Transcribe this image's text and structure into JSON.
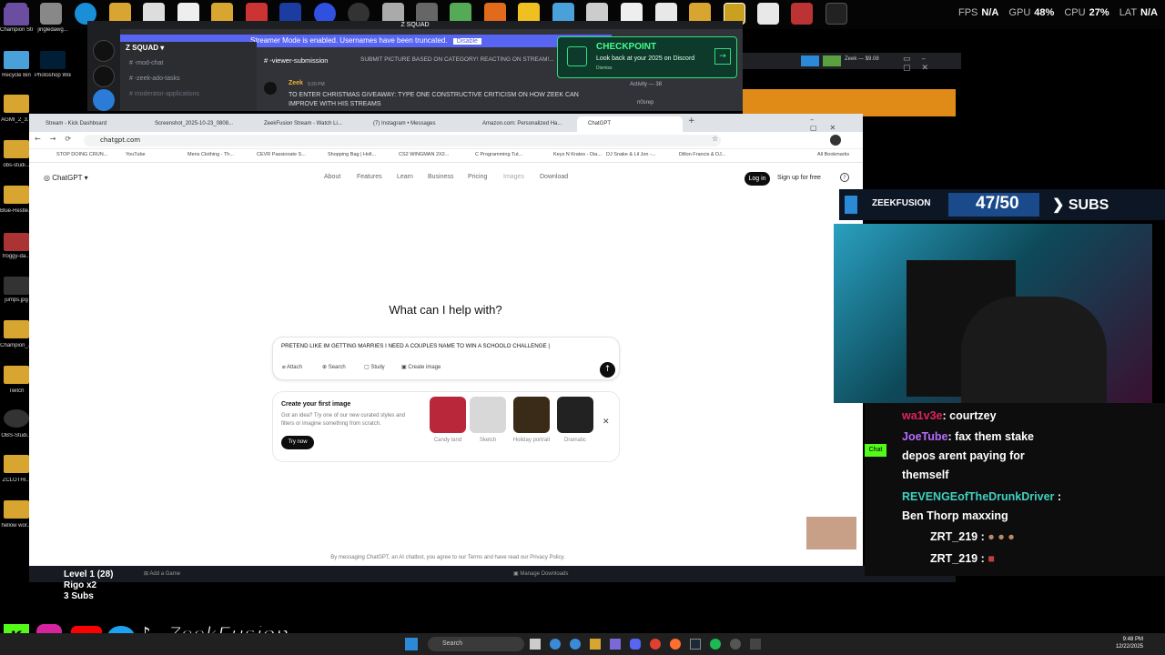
{
  "perf": {
    "fps_label": "FPS",
    "fps": "N/A",
    "gpu_label": "GPU",
    "gpu": "48%",
    "cpu_label": "CPU",
    "cpu": "27%",
    "lat_label": "LAT",
    "lat": "N/A"
  },
  "desktop_icons": [
    "Champion Stream Ov...",
    "Recycle Bin",
    "AGMI_2_3...",
    "obs-studi...",
    "Blue-Restle...",
    "froggy-da...",
    "jumps.jpg",
    "Champion_...",
    "Twitch",
    "OBS-Studi...",
    "ZCLOTHI...",
    "hellow wor..."
  ],
  "desktop_icons2": [
    "jingledawg...",
    "Photoshop Work"
  ],
  "discord": {
    "window_title": "Z SQUAD",
    "banner_text": "Streamer Mode is enabled. Usernames have been truncated.",
    "banner_button": "Disable",
    "server_name": "Z SQUAD",
    "channels": [
      "-mod-chat",
      "-zeek-ado-tasks",
      "moderator-applications"
    ],
    "channel_header": "-viewer-submission",
    "channel_topic": "SUBMIT PICTURE BASED ON CATEGORY! REACTING ON STREAM!...",
    "author": "Zeek",
    "time": "9:20 PM",
    "message": "TO ENTER CHRISTMAS GIVEAWAY: TYPE ONE CONSTRUCTIVE CRITICISM ON HOW ZEEK CAN IMPROVE WITH HIS STREAMS",
    "activity": "Activity — 38",
    "activity_user": "n0srep"
  },
  "checkpoint": {
    "title": "CHECKPOINT",
    "subtitle": "Look back at your 2025 on Discord",
    "dismiss": "Dismiss"
  },
  "right_window": {
    "title": "Zeek — $9.08"
  },
  "browser": {
    "tabs": [
      "Stream - Kick Dashboard",
      "Screenshot_2025-10-23_0808...",
      "ZeekFusion Stream - Watch Li...",
      "(7) Instagram • Messages",
      "Amazon.com: Personalized Ha...",
      "ChatGPT"
    ],
    "url": "chatgpt.com",
    "bookmarks": [
      "STOP DOING CRUN...",
      "YouTube",
      "Mens Clothing - Th...",
      "CEVR Passionate S...",
      "Shopping Bag | Holl...",
      "CS2 WINGMAN 2X2...",
      "C Programming Tut...",
      "Keys N Krates - Dia...",
      "DJ Snake & Lil Jon -...",
      "Dillon Francis & DJ..."
    ],
    "all_bookmarks": "All Bookmarks"
  },
  "chatgpt": {
    "brand": "ChatGPT",
    "nav": [
      "About",
      "Features",
      "Learn",
      "Business",
      "Pricing",
      "Images",
      "Download"
    ],
    "login": "Log in",
    "signup": "Sign up for free",
    "headline": "What can I help with?",
    "prompt": "PRETEND LIKE IM GETTING MARRIES I NEED A COUPLES NAME TO WIN A SCHOOLO CHALLENGE |",
    "buttons": [
      "Attach",
      "Search",
      "Study",
      "Create image"
    ],
    "card_title": "Create your first image",
    "card_desc": "Got an idea? Try one of our new curated styles and filters or imagine something from scratch.",
    "try_now": "Try now",
    "styles": [
      "Candy land",
      "Sketch",
      "Holiday portrait",
      "Dramatic"
    ],
    "terms": "By messaging ChatGPT, an AI chatbot, you agree to our Terms and have read our Privacy Policy."
  },
  "steam": {
    "add_game": "Add a Game",
    "manage": "Manage Downloads",
    "friends": "Friends & Chat"
  },
  "stream": {
    "brand": "ZEEKFUSION",
    "sub_count": "47/50",
    "sub_label": "SUBS",
    "level": "Level 1 (28)",
    "rigo": "Rigo x2",
    "subs_small": "3 Subs",
    "handle": "ZeekFusion"
  },
  "chat": [
    {
      "user": "wa1v3e",
      "text": ": courtzey",
      "color": "#e0245e"
    },
    {
      "user": "JoeTube",
      "text": ": fax them stake",
      "color": "#b86bff"
    },
    {
      "user": "",
      "text": "depos arent paying for",
      "color": "#fff"
    },
    {
      "user": "",
      "text": "themself",
      "color": "#fff"
    },
    {
      "user": "REVENGEofTheDrunkDriver",
      "text": " :",
      "color": "#3fd0c0"
    },
    {
      "user": "",
      "text": "Ben Thorp maxxing",
      "color": "#fff"
    },
    {
      "user": "ZRT_219",
      "text": " :",
      "color": "#fff"
    },
    {
      "user": "ZRT_219",
      "text": " :",
      "color": "#fff"
    }
  ],
  "taskbar": {
    "search": "Search",
    "time": "9:48 PM",
    "date": "12/22/2025"
  },
  "colors": {
    "discord_bg": "#313338",
    "discord_accent": "#5865f2",
    "kick_green": "#53fc18",
    "chatgpt_black": "#0d0d0d"
  }
}
